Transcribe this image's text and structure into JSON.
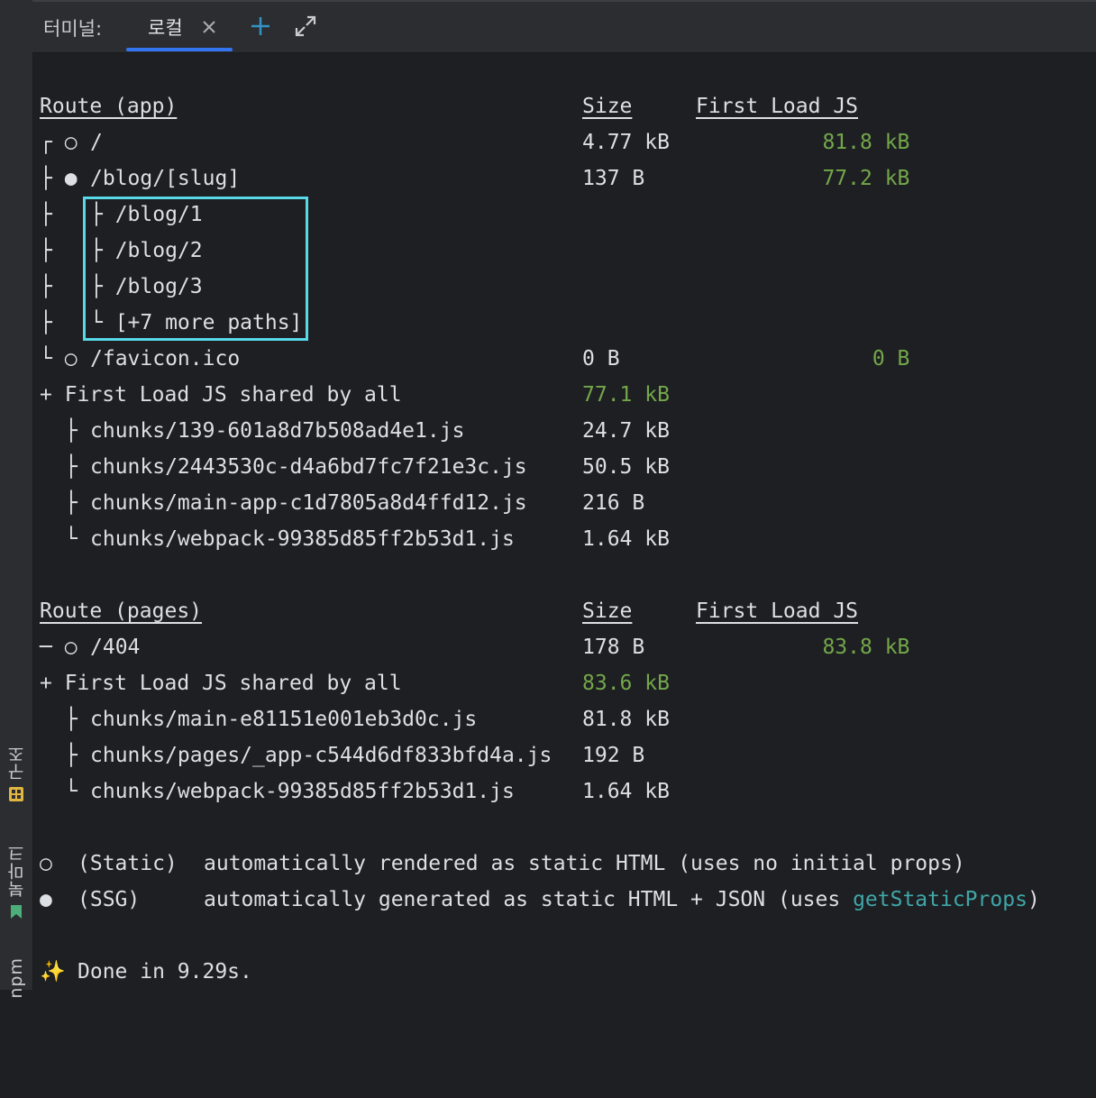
{
  "sidebar": {
    "structure_label": "구조",
    "bookmarks_label": "북마크",
    "npm_label": "npm"
  },
  "tabbar": {
    "title": "터미널:",
    "tab_label": "로컬",
    "accent": "#3574f0"
  },
  "colors": {
    "green": "#73a74a",
    "teal": "#3fa6a8",
    "highlight": "#57d9e8"
  },
  "app": {
    "header": {
      "route": "Route (app)",
      "size": "Size",
      "first": "First Load JS"
    },
    "rows": [
      {
        "prefix": "┌ ○ ",
        "path": "/",
        "size": "4.77 kB",
        "first": "81.8 kB"
      },
      {
        "prefix": "├ ● ",
        "path": "/blog/[slug]",
        "size": "137 B",
        "first": "77.2 kB"
      },
      {
        "prefix": "├    ",
        "path": "├ /blog/1",
        "size": "",
        "first": ""
      },
      {
        "prefix": "├    ",
        "path": "├ /blog/2",
        "size": "",
        "first": ""
      },
      {
        "prefix": "├    ",
        "path": "├ /blog/3",
        "size": "",
        "first": ""
      },
      {
        "prefix": "├    ",
        "path": "└ [+7 more paths]",
        "size": "",
        "first": ""
      },
      {
        "prefix": "└ ○ ",
        "path": "/favicon.ico",
        "size": "0 B",
        "first": "0 B"
      }
    ],
    "shared": {
      "label": "+ First Load JS shared by all",
      "size": "77.1 kB"
    },
    "chunks": [
      {
        "tree": "├",
        "name": "chunks/139-601a8d7b508ad4e1.js",
        "size": "24.7 kB"
      },
      {
        "tree": "├",
        "name": "chunks/2443530c-d4a6bd7fc7f21e3c.js",
        "size": "50.5 kB"
      },
      {
        "tree": "├",
        "name": "chunks/main-app-c1d7805a8d4ffd12.js",
        "size": "216 B"
      },
      {
        "tree": "└",
        "name": "chunks/webpack-99385d85ff2b53d1.js",
        "size": "1.64 kB"
      }
    ]
  },
  "pages": {
    "header": {
      "route": "Route (pages)",
      "size": "Size",
      "first": "First Load JS"
    },
    "rows": [
      {
        "prefix": "─ ○ ",
        "path": "/404",
        "size": "178 B",
        "first": "83.8 kB"
      }
    ],
    "shared": {
      "label": "+ First Load JS shared by all",
      "size": "83.6 kB"
    },
    "chunks": [
      {
        "tree": "├",
        "name": "chunks/main-e81151e001eb3d0c.js",
        "size": "81.8 kB"
      },
      {
        "tree": "├",
        "name": "chunks/pages/_app-c544d6df833bfd4a.js",
        "size": "192 B"
      },
      {
        "tree": "└",
        "name": "chunks/webpack-99385d85ff2b53d1.js",
        "size": "1.64 kB"
      }
    ]
  },
  "legend": [
    {
      "symbol": "○",
      "kind": "(Static)",
      "desc": "automatically rendered as static HTML (uses no initial props)"
    },
    {
      "symbol": "●",
      "kind": "(SSG)",
      "desc_pre": "automatically generated as static HTML + JSON (uses ",
      "desc_fn": "getStaticProps",
      "desc_post": ")"
    }
  ],
  "done": {
    "icon": "✨",
    "text": "Done in 9.29s."
  }
}
